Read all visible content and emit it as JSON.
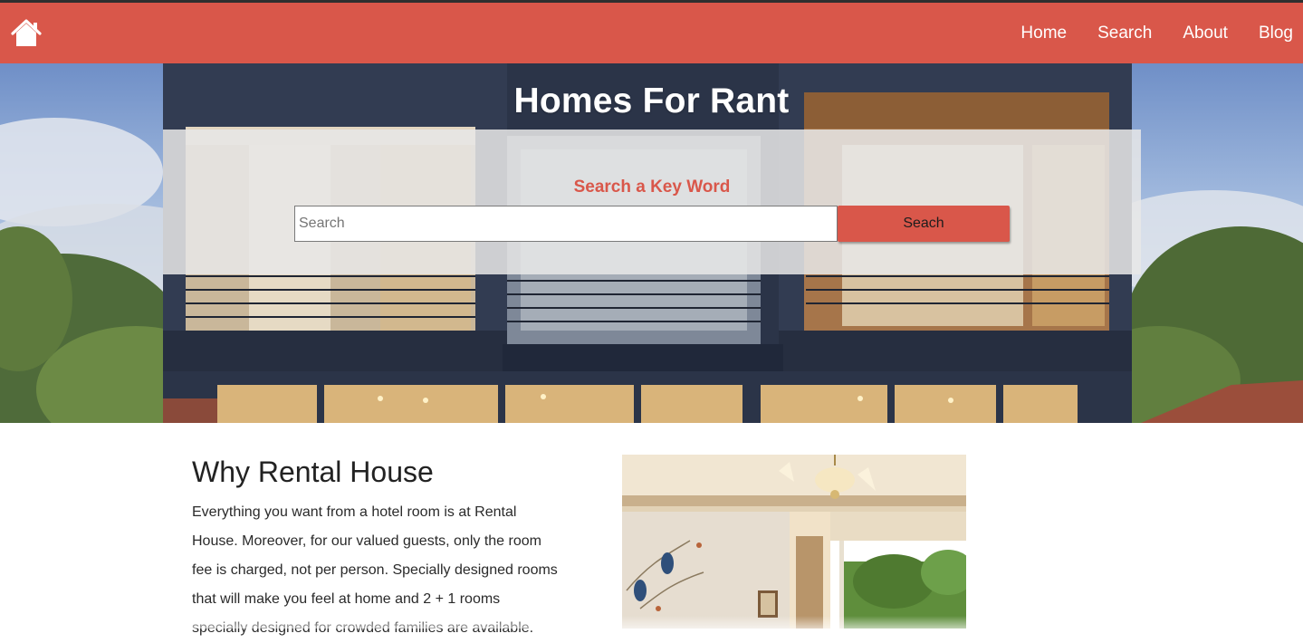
{
  "nav": {
    "brand_icon": "home-icon",
    "links": [
      {
        "label": "Home"
      },
      {
        "label": "Search"
      },
      {
        "label": "About"
      },
      {
        "label": "Blog"
      }
    ]
  },
  "hero": {
    "title": "Homes For Rant",
    "search_heading": "Search a Key Word",
    "search_placeholder": "Search",
    "search_value": "",
    "search_button": "Seach"
  },
  "section": {
    "title": "Why Rental House",
    "text": "Everything you want from a hotel room is at Rental House. Moreover, for our valued guests, only the room fee is charged, not per person. Specially designed rooms that will make you feel at home and 2 + 1 rooms specially designed for crowded families are available."
  },
  "colors": {
    "accent": "#d9574a",
    "text": "#222222"
  }
}
